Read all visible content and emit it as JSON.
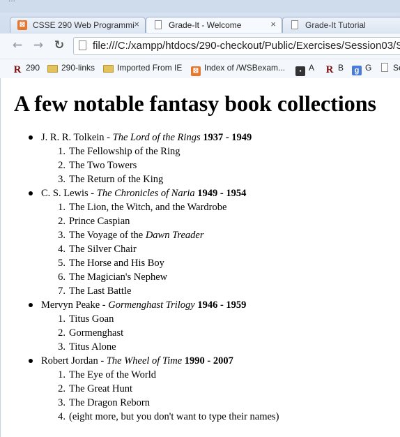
{
  "window_title": "...",
  "tabs": [
    {
      "label": "CSSE 290 Web Programmi",
      "close": "×",
      "icon": "xampp-icon"
    },
    {
      "label": "Grade-It - Welcome",
      "close": "×",
      "icon": "page-icon"
    },
    {
      "label": "Grade-It Tutorial",
      "close": "",
      "icon": "page-icon"
    }
  ],
  "address_bar": {
    "url": "file:///C:/xampp/htdocs/290-checkout/Public/Exercises/Session03/S"
  },
  "bookmarks": [
    {
      "label": "290",
      "icon": "r-icon"
    },
    {
      "label": "290-links",
      "icon": "folder-icon"
    },
    {
      "label": "Imported From IE",
      "icon": "folder-icon"
    },
    {
      "label": "Index of /WSBexam...",
      "icon": "xampp-icon"
    },
    {
      "label": "A",
      "icon": "dark-icon"
    },
    {
      "label": "B",
      "icon": "r-icon"
    },
    {
      "label": "G",
      "icon": "g-icon"
    },
    {
      "label": "Se",
      "icon": "page-icon"
    }
  ],
  "page": {
    "heading": "A few notable fantasy book collections",
    "collections": [
      {
        "author": "J. R. R. Tolkein - ",
        "series": "The Lord of the Rings",
        "years": " 1937 - 1949",
        "books": [
          {
            "num": "1.",
            "title": "The Fellowship of the Ring"
          },
          {
            "num": "2.",
            "title": "The Two Towers"
          },
          {
            "num": "3.",
            "title": "The Return of the King"
          }
        ]
      },
      {
        "author": "C. S. Lewis - ",
        "series": "The Chronicles of Naria",
        "years": " 1949 - 1954",
        "books": [
          {
            "num": "1.",
            "title": "The Lion, the Witch, and the Wardrobe"
          },
          {
            "num": "2.",
            "title": "Prince Caspian"
          },
          {
            "num": "3.",
            "title": "The Voyage of the ",
            "title_italic": "Dawn Treader"
          },
          {
            "num": "4.",
            "title": "The Silver Chair"
          },
          {
            "num": "5.",
            "title": "The Horse and His Boy"
          },
          {
            "num": "6.",
            "title": "The Magician's Nephew"
          },
          {
            "num": "7.",
            "title": "The Last Battle"
          }
        ]
      },
      {
        "author": "Mervyn Peake - ",
        "series": "Gormenghast Trilogy",
        "years": " 1946 - 1959",
        "books": [
          {
            "num": "1.",
            "title": "Titus Goan"
          },
          {
            "num": "2.",
            "title": "Gormenghast"
          },
          {
            "num": "3.",
            "title": "Titus Alone"
          }
        ]
      },
      {
        "author": "Robert Jordan - ",
        "series": "The Wheel of Time",
        "years": " 1990 - 2007",
        "books": [
          {
            "num": "1.",
            "title": "The Eye of the World"
          },
          {
            "num": "2.",
            "title": "The Great Hunt"
          },
          {
            "num": "3.",
            "title": "The Dragon Reborn"
          },
          {
            "num": "4.",
            "title": "(eight more, but you don't want to type their names)"
          }
        ]
      }
    ]
  }
}
